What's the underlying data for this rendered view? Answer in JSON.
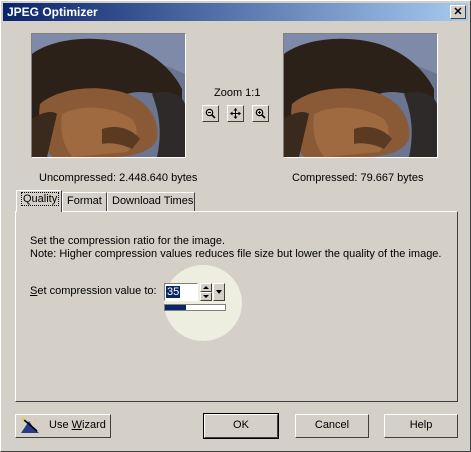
{
  "window": {
    "title": "JPEG Optimizer",
    "close_glyph": "✕"
  },
  "preview": {
    "zoom_label": "Zoom 1:1",
    "uncompressed_label": "Uncompressed:  2.448.640 bytes",
    "compressed_label": "Compressed: 79.667 bytes",
    "zoom_buttons": [
      "zoom-out-icon",
      "move-icon",
      "zoom-in-icon"
    ]
  },
  "tabs": [
    {
      "label": "Quality",
      "active": true
    },
    {
      "label": "Format",
      "active": false
    },
    {
      "label": "Download Times",
      "active": false
    }
  ],
  "quality": {
    "description": "Set the compression ratio for the image.",
    "note": "Note:  Higher compression values reduces file size but lower the quality of the image.",
    "compression_label_prefix": "S",
    "compression_label_rest": "et compression value to:",
    "compression_value": "35",
    "slider_fraction": 0.35
  },
  "buttons": {
    "wizard_use": "Use ",
    "wizard_accel": "W",
    "wizard_rest": "izard",
    "ok": "OK",
    "cancel": "Cancel",
    "help": "Help"
  },
  "colors": {
    "titlebar_start": "#0a246a",
    "titlebar_end": "#a6caf0",
    "face": "#d4d0c8",
    "selection": "#0a246a"
  }
}
